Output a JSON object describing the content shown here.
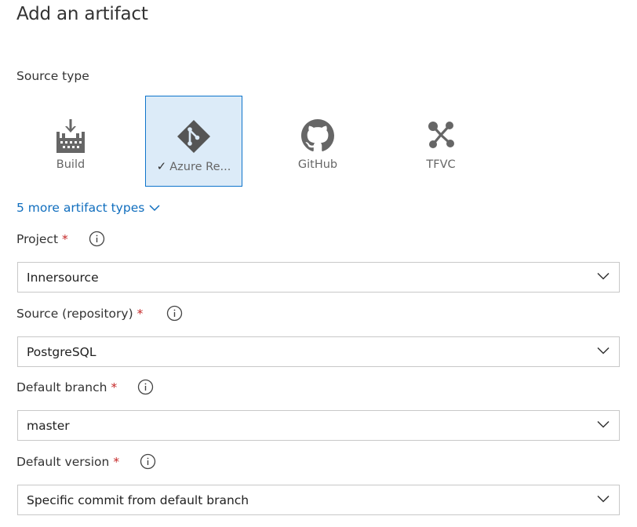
{
  "page": {
    "title": "Add an artifact"
  },
  "source_type": {
    "label": "Source type",
    "tiles": [
      {
        "label": "Build",
        "icon": "build-icon",
        "selected": false
      },
      {
        "label": "Azure Re...",
        "icon": "azure-repos-icon",
        "selected": true,
        "check": "✓"
      },
      {
        "label": "GitHub",
        "icon": "github-icon",
        "selected": false
      },
      {
        "label": "TFVC",
        "icon": "tfvc-icon",
        "selected": false
      }
    ],
    "selected_color": "#dcebf8",
    "selected_border": "#0e74cb"
  },
  "more_types": {
    "label": "5 more artifact types"
  },
  "fields": {
    "project": {
      "label": "Project",
      "required": "*",
      "value": "Innersource"
    },
    "source": {
      "label": "Source (repository)",
      "required": "*",
      "value": "PostgreSQL"
    },
    "branch": {
      "label": "Default branch",
      "required": "*",
      "value": "master"
    },
    "version": {
      "label": "Default version",
      "required": "*",
      "value": "Specific commit from default branch"
    }
  },
  "colors": {
    "link": "#106ebe",
    "required": "#c52828",
    "icon": "#666666"
  }
}
